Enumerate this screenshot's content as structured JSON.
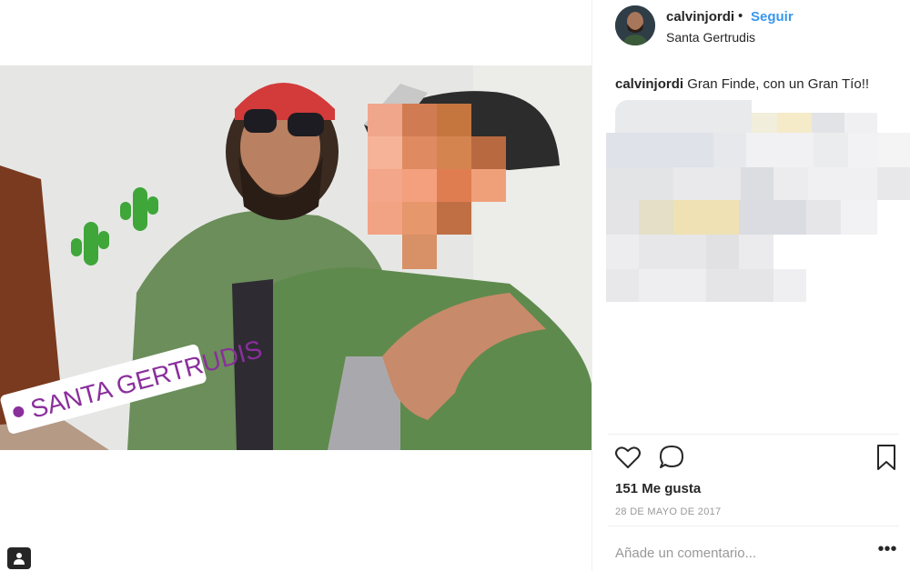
{
  "post": {
    "username": "calvinjordi",
    "separator": "•",
    "follow_label": "Seguir",
    "location": "Santa Gertrudis",
    "caption_user": "calvinjordi",
    "caption_text": " Gran Finde, con un Gran Tío!!",
    "likes_text": "151 Me gusta",
    "date": "28 DE MAYO DE 2017",
    "comment_placeholder": "Añade un comentario...",
    "more_label": "•••"
  },
  "photo": {
    "sticker_text": "SANTA GERTRUDIS"
  },
  "icons": {
    "like": "heart-icon",
    "comment": "comment-bubble-icon",
    "save": "bookmark-icon",
    "user_tag": "person-tag-icon",
    "location_pin": "location-pin-icon",
    "more": "more-options-icon"
  },
  "colors": {
    "link_blue": "#3897f0",
    "text": "#262626",
    "muted": "#999999"
  }
}
